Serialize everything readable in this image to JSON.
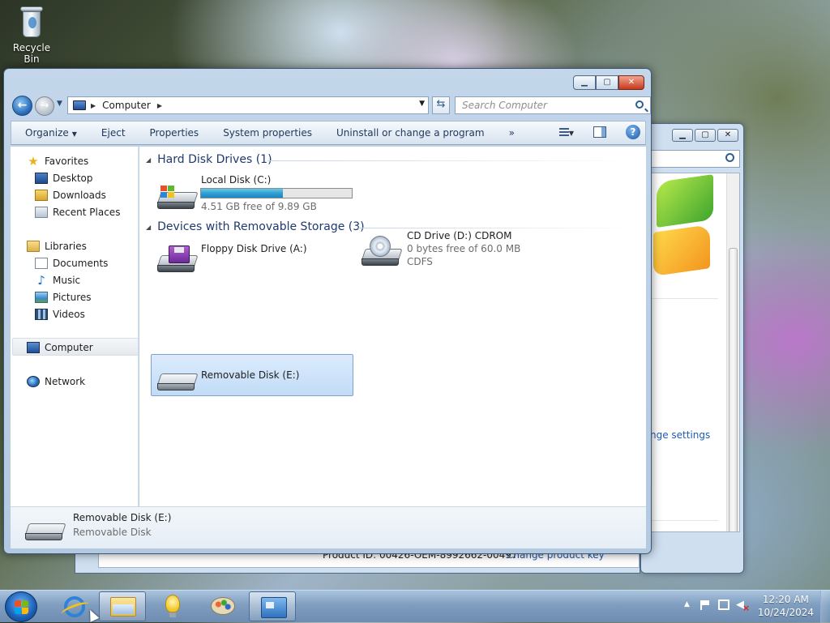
{
  "desktop": {
    "recycle_bin_label": "Recycle Bin"
  },
  "background_window": {
    "link_text": "nge settings",
    "product_id": "Product ID: 00426-OEM-8992662-00497",
    "change_product_key": "Change product key"
  },
  "explorer": {
    "caption_buttons": {
      "minimize": "▁",
      "maximize": "▢",
      "close": "✕"
    },
    "address": {
      "crumb": "Computer"
    },
    "search": {
      "placeholder": "Search Computer"
    },
    "toolbar": {
      "organize": "Organize",
      "eject": "Eject",
      "properties": "Properties",
      "system_properties": "System properties",
      "uninstall": "Uninstall or change a program",
      "more": "»"
    },
    "nav": {
      "favorites": "Favorites",
      "desktop": "Desktop",
      "downloads": "Downloads",
      "recent_places": "Recent Places",
      "libraries": "Libraries",
      "documents": "Documents",
      "music": "Music",
      "pictures": "Pictures",
      "videos": "Videos",
      "computer": "Computer",
      "network": "Network"
    },
    "groups": {
      "hdd_header": "Hard Disk Drives (1)",
      "removable_header": "Devices with Removable Storage (3)"
    },
    "drives": {
      "local_disk": {
        "name": "Local Disk (C:)",
        "free": "4.51 GB free of 9.89 GB",
        "used_fraction": 0.544
      },
      "floppy": {
        "name": "Floppy Disk Drive (A:)"
      },
      "cd": {
        "name": "CD Drive (D:) CDROM",
        "free": "0 bytes free of 60.0 MB",
        "fs": "CDFS"
      },
      "removable": {
        "name": "Removable Disk (E:)"
      }
    },
    "details": {
      "title": "Removable Disk (E:)",
      "type": "Removable Disk"
    }
  },
  "taskbar": {
    "time": "12:20 AM",
    "date": "10/24/2024"
  },
  "colors": {
    "accent": "#1e3a6e",
    "progress": "#2b9bcf",
    "selection": "#c1dcf7"
  }
}
